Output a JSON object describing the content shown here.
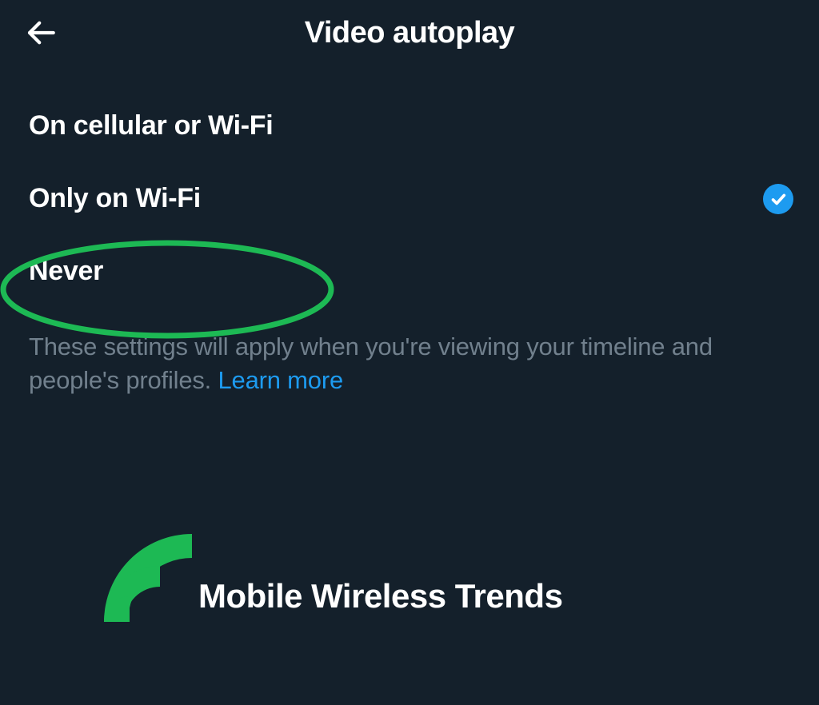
{
  "header": {
    "title": "Video autoplay"
  },
  "options": [
    {
      "label": "On cellular or Wi-Fi",
      "selected": false,
      "highlighted": false
    },
    {
      "label": "Only on Wi-Fi",
      "selected": true,
      "highlighted": false
    },
    {
      "label": "Never",
      "selected": false,
      "highlighted": true
    }
  ],
  "description": {
    "text": "These settings will apply when you're viewing your timeline and people's profiles. ",
    "link_text": "Learn more"
  },
  "watermark": {
    "text": "Mobile Wireless Trends"
  },
  "colors": {
    "accent": "#1d9bf0",
    "highlight": "#1db954",
    "background": "#14202b"
  }
}
